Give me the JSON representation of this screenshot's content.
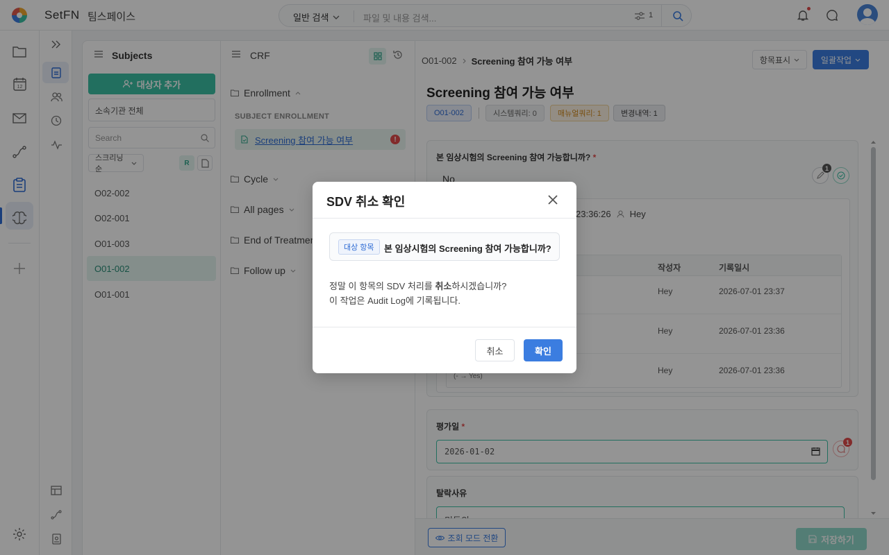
{
  "header": {
    "brand": "SetFN",
    "teamspace": "팀스페이스",
    "search_type": "일반 검색",
    "search_placeholder": "파일 및 내용 검색...",
    "filter_count": "1"
  },
  "subjects": {
    "title": "Subjects",
    "add_button": "대상자 추가",
    "org_select": "소속기관 전체",
    "search_placeholder": "Search",
    "sort_label": "스크리닝순",
    "r_toggle": "R",
    "items": [
      "O02-002",
      "O02-001",
      "O01-003",
      "O01-002",
      "O01-001"
    ],
    "selected": "O01-002"
  },
  "crf": {
    "title": "CRF",
    "folders": [
      "Enrollment",
      "Cycle",
      "All pages",
      "End of Treatment",
      "Follow up"
    ],
    "section": "SUBJECT ENROLLMENT",
    "page": "Screening 참여 가능 여부",
    "page_warning": "!"
  },
  "main": {
    "breadcrumb_subject": "O01-002",
    "breadcrumb_page": "Screening 참여 가능 여부",
    "display_button": "항목표시",
    "bulk_button": "일괄작업",
    "page_title": "Screening 참여 가능 여부",
    "chips": {
      "subject": "O01-002",
      "system_query": "시스템쿼리: 0",
      "manual_query": "매뉴얼쿼리: 1",
      "changes": "변경내역: 1"
    },
    "question": {
      "label": "본 임상시험의 Screening 참여 가능합니까?",
      "required_mark": "*",
      "answer": "No",
      "comment_count": "1",
      "history_time": "23:36:26",
      "history_user": "Hey",
      "table_headers": [
        "작성자",
        "기록일시"
      ],
      "rows": [
        {
          "author": "Hey",
          "date": "2026-07-01 23:37",
          "note": ""
        },
        {
          "author": "Hey",
          "date": "2026-07-01 23:36",
          "note": ""
        },
        {
          "author": "Hey",
          "date": "2026-07-01 23:36",
          "note": "(- → Yes)"
        }
      ]
    },
    "date_field": {
      "label": "평가일",
      "required_mark": "*",
      "value": "2026-01-02",
      "query_count": "1"
    },
    "drop_field": {
      "label": "탈락사유",
      "value": "미동의"
    },
    "view_mode_button": "조회 모드 전환",
    "save_button": "저장하기"
  },
  "modal": {
    "title": "SDV 취소 확인",
    "target_tag": "대상 항목",
    "target_text": "본 임상시험의 Screening 참여 가능합니까?",
    "message_pre": "정말 이 항목의 SDV 처리를 ",
    "message_bold": "취소",
    "message_post": "하시겠습니까?",
    "message_line2": "이 작업은 Audit Log에 기록됩니다.",
    "cancel_button": "취소",
    "ok_button": "확인"
  },
  "colors": {
    "accent_teal": "#3bbfa4",
    "accent_blue": "#3b7de0",
    "danger": "#e04b4b"
  },
  "icons": [
    "logo-icon",
    "chevron-down-icon",
    "filter-icon",
    "search-icon",
    "bell-icon",
    "chat-icon",
    "avatar-icon",
    "folder-icon",
    "calendar-icon",
    "mail-icon",
    "route-icon",
    "clipboard-icon",
    "brain-icon",
    "plus-icon",
    "settings-icon",
    "expand-icon",
    "users-icon",
    "clock-icon",
    "activity-icon",
    "layout-icon",
    "id-badge-icon",
    "menu-icon",
    "user-plus-icon",
    "document-icon",
    "grid-icon",
    "history-icon",
    "edit-icon",
    "check-circle-icon",
    "eye-icon",
    "save-icon",
    "close-icon"
  ]
}
